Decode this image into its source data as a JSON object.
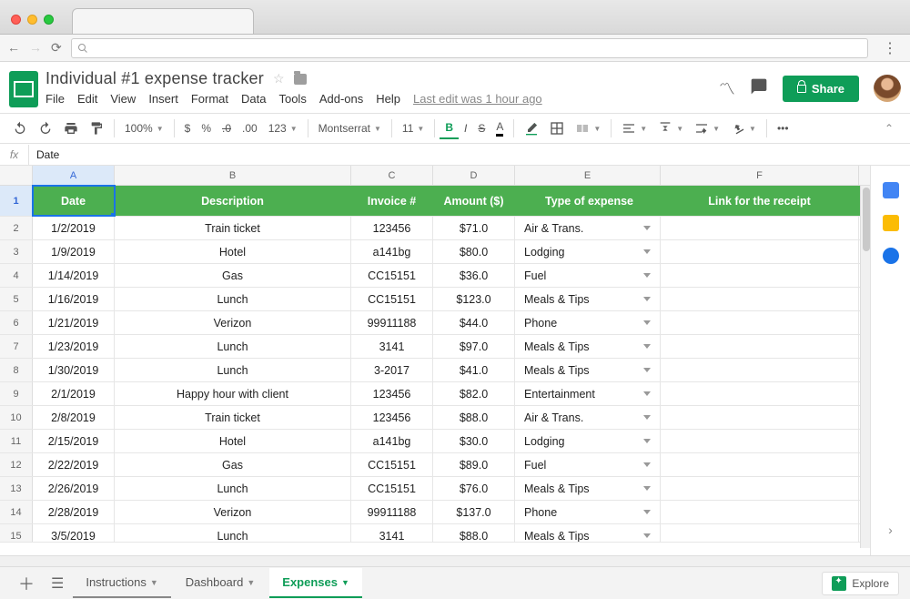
{
  "doc": {
    "title": "Individual #1 expense tracker",
    "last_edit": "Last edit was 1 hour ago"
  },
  "menu": {
    "file": "File",
    "edit": "Edit",
    "view": "View",
    "insert": "Insert",
    "format": "Format",
    "data": "Data",
    "tools": "Tools",
    "addons": "Add-ons",
    "help": "Help"
  },
  "share_label": "Share",
  "toolbar": {
    "zoom": "100%",
    "currency_symbol": "$",
    "percent": "%",
    "decimal_dec": ".0",
    "decimal_inc": ".00",
    "formats": "123",
    "font": "Montserrat",
    "size": "11",
    "bold": "B",
    "italic": "I",
    "strike": "S",
    "text_a": "A",
    "more": "•••"
  },
  "fx": {
    "label": "fx",
    "value": "Date"
  },
  "columns": [
    "A",
    "B",
    "C",
    "D",
    "E",
    "F"
  ],
  "headers": {
    "date": "Date",
    "description": "Description",
    "invoice": "Invoice #",
    "amount": "Amount ($)",
    "type": "Type of expense",
    "link": "Link for the receipt"
  },
  "rows": [
    {
      "n": 2,
      "date": "1/2/2019",
      "desc": "Train ticket",
      "inv": "123456",
      "amt": "$71.0",
      "type": "Air & Trans."
    },
    {
      "n": 3,
      "date": "1/9/2019",
      "desc": "Hotel",
      "inv": "a141bg",
      "amt": "$80.0",
      "type": "Lodging"
    },
    {
      "n": 4,
      "date": "1/14/2019",
      "desc": "Gas",
      "inv": "CC15151",
      "amt": "$36.0",
      "type": "Fuel"
    },
    {
      "n": 5,
      "date": "1/16/2019",
      "desc": "Lunch",
      "inv": "CC15151",
      "amt": "$123.0",
      "type": "Meals & Tips"
    },
    {
      "n": 6,
      "date": "1/21/2019",
      "desc": "Verizon",
      "inv": "99911188",
      "amt": "$44.0",
      "type": "Phone"
    },
    {
      "n": 7,
      "date": "1/23/2019",
      "desc": "Lunch",
      "inv": "3141",
      "amt": "$97.0",
      "type": "Meals & Tips"
    },
    {
      "n": 8,
      "date": "1/30/2019",
      "desc": "Lunch",
      "inv": "3-2017",
      "amt": "$41.0",
      "type": "Meals & Tips"
    },
    {
      "n": 9,
      "date": "2/1/2019",
      "desc": "Happy hour with client",
      "inv": "123456",
      "amt": "$82.0",
      "type": "Entertainment"
    },
    {
      "n": 10,
      "date": "2/8/2019",
      "desc": "Train ticket",
      "inv": "123456",
      "amt": "$88.0",
      "type": "Air & Trans."
    },
    {
      "n": 11,
      "date": "2/15/2019",
      "desc": "Hotel",
      "inv": "a141bg",
      "amt": "$30.0",
      "type": "Lodging"
    },
    {
      "n": 12,
      "date": "2/22/2019",
      "desc": "Gas",
      "inv": "CC15151",
      "amt": "$89.0",
      "type": "Fuel"
    },
    {
      "n": 13,
      "date": "2/26/2019",
      "desc": "Lunch",
      "inv": "CC15151",
      "amt": "$76.0",
      "type": "Meals & Tips"
    },
    {
      "n": 14,
      "date": "2/28/2019",
      "desc": "Verizon",
      "inv": "99911188",
      "amt": "$137.0",
      "type": "Phone"
    },
    {
      "n": 15,
      "date": "3/5/2019",
      "desc": "Lunch",
      "inv": "3141",
      "amt": "$88.0",
      "type": "Meals & Tips"
    }
  ],
  "tabs": {
    "instructions": "Instructions",
    "dashboard": "Dashboard",
    "expenses": "Expenses"
  },
  "explore_label": "Explore"
}
